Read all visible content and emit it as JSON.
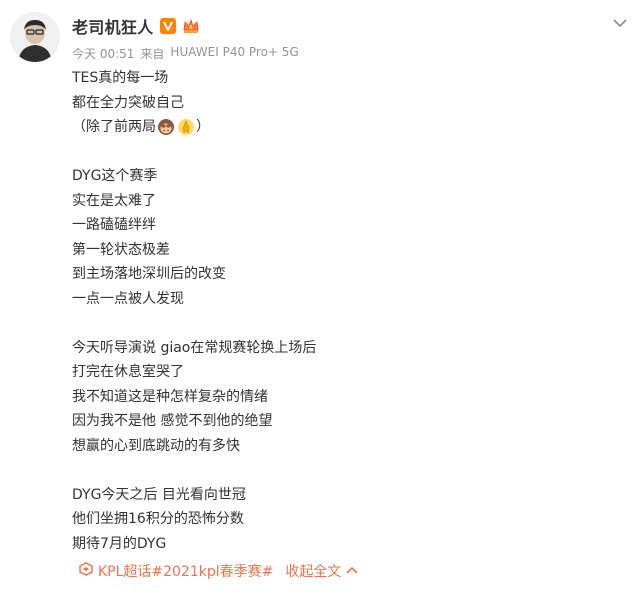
{
  "user": {
    "name": "老司机狂人"
  },
  "meta": {
    "time": "今天 00:51",
    "from_label": "来自",
    "device": "HUAWEI P40 Pro+ 5G"
  },
  "post": {
    "lines": [
      "TES真的每一场",
      "都在全力突破自己",
      "（除了前两局",
      "",
      "DYG这个赛季",
      "实在是太难了",
      "一路磕磕绊绊",
      "第一轮状态极差",
      "到主场落地深圳后的改变",
      "一点一点被人发现",
      "",
      "今天听导演说 giao在常规赛轮换上场后",
      "打完在休息室哭了",
      "我不知道这是种怎样复杂的情绪",
      "因为我不是他 感觉不到他的绝望",
      "想赢的心到底跳动的有多快",
      "",
      "DYG今天之后 目光看向世冠",
      "他们坐拥16积分的恐怖分数",
      "期待7月的DYG"
    ],
    "line3_suffix": "）"
  },
  "footer": {
    "topic_link": "KPL超话#2021kpl春季赛#",
    "collapse_label": "收起全文"
  },
  "colors": {
    "accent": "#eb7350",
    "verify": "#ff8200",
    "meta_text": "#939393",
    "body_text": "#333333"
  },
  "icons": {
    "verify": "verified-v-icon",
    "crown": "crown-icon",
    "dropdown": "chevron-down-icon",
    "topic": "super-topic-icon",
    "collapse": "chevron-up-icon"
  }
}
